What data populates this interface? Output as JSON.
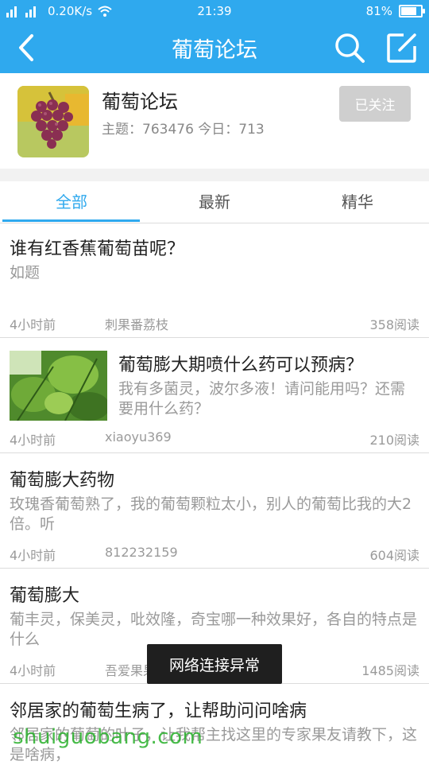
{
  "status_bar": {
    "signal": "46",
    "net_speed": "0.20K/s",
    "time": "21:39",
    "battery": "81%",
    "battery_level": 0.81
  },
  "nav": {
    "title": "葡萄论坛",
    "back_icon": "chevron-left-icon",
    "search_icon": "search-icon",
    "compose_icon": "edit-icon"
  },
  "forum": {
    "name": "葡萄论坛",
    "stats": "主题：763476  今日：713",
    "follow_label": "已关注"
  },
  "tabs": [
    {
      "label": "全部",
      "active": true
    },
    {
      "label": "最新",
      "active": false
    },
    {
      "label": "精华",
      "active": false
    }
  ],
  "posts": [
    {
      "title": "谁有红香蕉葡萄苗呢？",
      "excerpt": "如题",
      "time": "4小时前",
      "author": "刺果番荔枝",
      "reads": "358阅读"
    },
    {
      "title": "葡萄膨大期喷什么药可以预病？",
      "excerpt": "我有多菌灵，波尔多液！请问能用吗？还需要用什么药？",
      "time": "4小时前",
      "author": "xiaoyu369",
      "reads": "210阅读",
      "has_image": true
    },
    {
      "title": "葡萄膨大药物",
      "excerpt": "玫瑰香葡萄熟了，我的葡萄颗粒太小，别人的葡萄比我的大2倍。听",
      "time": "4小时前",
      "author": "812232159",
      "reads": "604阅读"
    },
    {
      "title": "葡萄膨大",
      "excerpt": "葡丰灵，保美灵，吡效隆，奇宝哪一种效果好，各自的特点是什么",
      "time": "4小时前",
      "author": "吾爱果果",
      "reads": "1485阅读"
    },
    {
      "title": "邻居家的葡萄生病了，让帮助问问啥病",
      "excerpt": "邻居家的葡萄的叶子，让我帮主找这里的专家果友请教下，这是啥病，"
    }
  ],
  "toast": "网络连接异常",
  "watermark": "shuiguobang.com"
}
